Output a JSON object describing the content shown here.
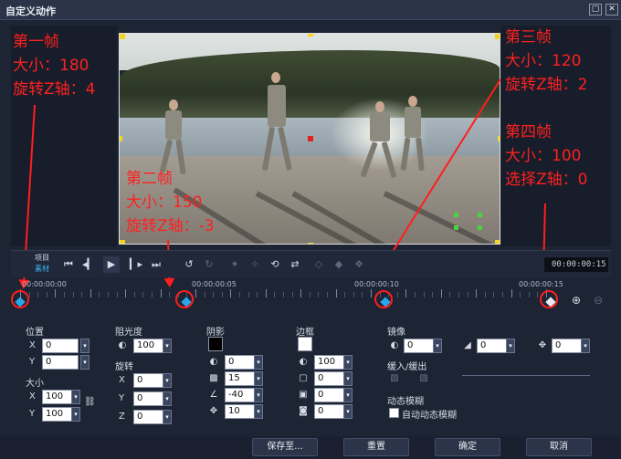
{
  "window": {
    "title": "自定义动作",
    "restore_icon": "▢",
    "close_icon": "✕"
  },
  "annotations": {
    "frame1": [
      "第一帧",
      "大小：180",
      "旋转Z轴：4"
    ],
    "frame2": [
      "第二帧",
      "大小：150",
      "旋转Z轴：-3"
    ],
    "frame3": [
      "第三帧",
      "大小：120",
      "旋转Z轴：2"
    ],
    "frame4": [
      "第四帧",
      "大小：100",
      "选择Z轴：0"
    ],
    "color": "#ff1e1e"
  },
  "playback": {
    "mode_project": "项目",
    "mode_clip": "素材",
    "timecode": "00:00:00:15",
    "icons": [
      "go-start-icon",
      "prev-frame-icon",
      "play-icon",
      "next-frame-icon",
      "go-end-icon",
      "rotate-left-icon",
      "rotate-right-icon"
    ]
  },
  "timeline": {
    "labels": [
      "00:00:00:00",
      "00:00:00:05",
      "00:00:00:10",
      "00:00:00:15"
    ],
    "keyframe_color": "#2aa7e8"
  },
  "position": {
    "label": "位置",
    "x_label": "X",
    "x": "0",
    "y_label": "Y",
    "y": "0"
  },
  "size": {
    "label": "大小",
    "x_label": "X",
    "x": "100",
    "y_label": "Y",
    "y": "100"
  },
  "opacity": {
    "label": "阻光度",
    "value": "100"
  },
  "rotation": {
    "label": "旋转",
    "x_label": "X",
    "x": "0",
    "y_label": "Y",
    "y": "0",
    "z_label": "Z",
    "z": "0"
  },
  "shadow": {
    "label": "阴影",
    "color": "#000000",
    "opacity": "0",
    "blur": "15",
    "angle": "-40",
    "distance": "10"
  },
  "border": {
    "label": "边框",
    "color": "#ffffff",
    "opacity": "100",
    "width": "0",
    "v2": "0",
    "v3": "0"
  },
  "mirror": {
    "label": "镜像",
    "v1": "0",
    "v2": "0",
    "v3": "0"
  },
  "ease": {
    "label": "缓入/缓出"
  },
  "motion_blur": {
    "label": "动态模糊",
    "auto_label": "自动动态模糊"
  },
  "buttons": {
    "save_as": "保存至...",
    "reset": "重置",
    "ok": "确定",
    "cancel": "取消"
  }
}
